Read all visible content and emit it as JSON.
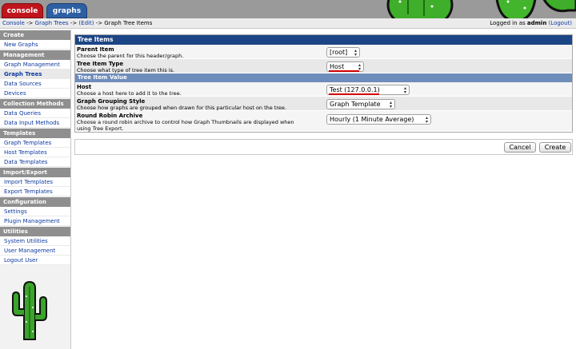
{
  "tabs": {
    "console": "console",
    "graphs": "graphs"
  },
  "breadcrumb": {
    "console": "Console",
    "sep1": " -> ",
    "graph_trees": "Graph Trees",
    "sep2": " -> ",
    "edit": "(Edit)",
    "sep3": " -> ",
    "current": "Graph Tree Items"
  },
  "login": {
    "prefix": "Logged in as ",
    "user": "admin",
    "logout": "(Logout)"
  },
  "sidebar": {
    "create_header": "Create",
    "new_graphs": "New Graphs",
    "management_header": "Management",
    "graph_management": "Graph Management",
    "graph_trees": "Graph Trees",
    "data_sources": "Data Sources",
    "devices": "Devices",
    "collection_header": "Collection Methods",
    "data_queries": "Data Queries",
    "data_input_methods": "Data Input Methods",
    "templates_header": "Templates",
    "graph_templates": "Graph Templates",
    "host_templates": "Host Templates",
    "data_templates": "Data Templates",
    "import_export_header": "Import/Export",
    "import_templates": "Import Templates",
    "export_templates": "Export Templates",
    "configuration_header": "Configuration",
    "settings": "Settings",
    "plugin_management": "Plugin Management",
    "utilities_header": "Utilities",
    "system_utilities": "System Utilities",
    "user_management": "User Management",
    "logout_user": "Logout User"
  },
  "form": {
    "panel_title": "Tree Items",
    "parent_item": {
      "title": "Parent Item",
      "desc": "Choose the parent for this header/graph.",
      "value": "[root]"
    },
    "tree_item_type": {
      "title": "Tree Item Type",
      "desc": "Choose what type of tree item this is.",
      "value": "Host"
    },
    "section_title": "Tree Item Value",
    "host": {
      "title": "Host",
      "desc": "Choose a host here to add it to the tree.",
      "value": "Test (127.0.0.1)"
    },
    "graph_grouping": {
      "title": "Graph Grouping Style",
      "desc": "Choose how graphs are grouped when drawn for this particular host on the tree.",
      "value": "Graph Template"
    },
    "rra": {
      "title": "Round Robin Archive",
      "desc": "Choose a round robin archive to control how Graph Thumbnails are displayed when using Tree Export.",
      "value": "Hourly (1 Minute Average)"
    }
  },
  "buttons": {
    "cancel": "Cancel",
    "create": "Create"
  },
  "colors": {
    "console_tab": "#c0151c",
    "graphs_tab": "#2e5fa3",
    "panel_header": "#1c4585",
    "section_header": "#6f8dbb",
    "annotation_underline": "#d40000"
  },
  "icons": {
    "dropdown": "chevron-updown-icon",
    "logo": "cactus-icon"
  }
}
